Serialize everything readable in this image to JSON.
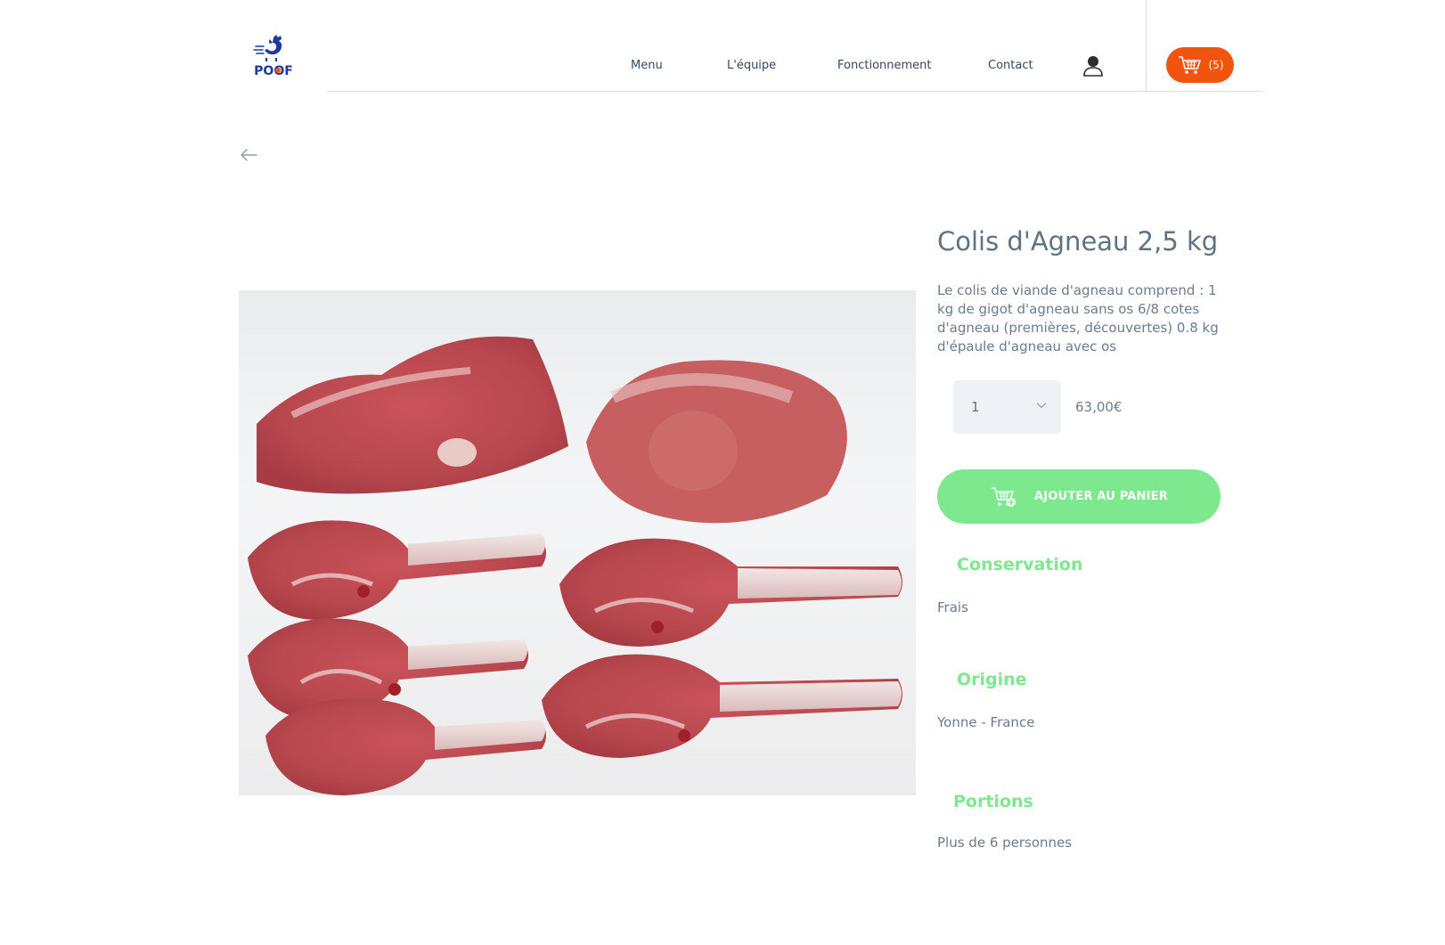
{
  "header": {
    "logo_text": "POOF",
    "nav": {
      "menu": "Menu",
      "equipe": "L'équipe",
      "fonctionnement": "Fonctionnement",
      "contact": "Contact"
    },
    "cart_count": "(5)"
  },
  "product": {
    "title": "Colis d'Agneau 2,5 kg",
    "description": "Le colis de viande d'agneau comprend : 1 kg de gigot d'agneau sans os 6/8 cotes d'agneau (premières, découvertes) 0.8 kg d'épaule d'agneau avec os",
    "quantity": "1",
    "price": "63,00€",
    "add_to_cart_label": "AJOUTER AU PANIER"
  },
  "details": {
    "conservation": {
      "title": "Conservation",
      "value": "Frais"
    },
    "origine": {
      "title": "Origine",
      "value": "Yonne - France"
    },
    "portions": {
      "title": "Portions",
      "value": "Plus de 6 personnes"
    }
  },
  "colors": {
    "accent_orange": "#f0540f",
    "accent_green": "#7ee88e",
    "logo_blue": "#1f3a9a",
    "text": "#6b7c8f"
  },
  "icons": {
    "logo": "rooster-logo",
    "user": "user-icon",
    "cart": "cart-icon",
    "back": "arrow-left-icon",
    "select": "chevron-down-icon",
    "add": "cart-plus-icon"
  }
}
